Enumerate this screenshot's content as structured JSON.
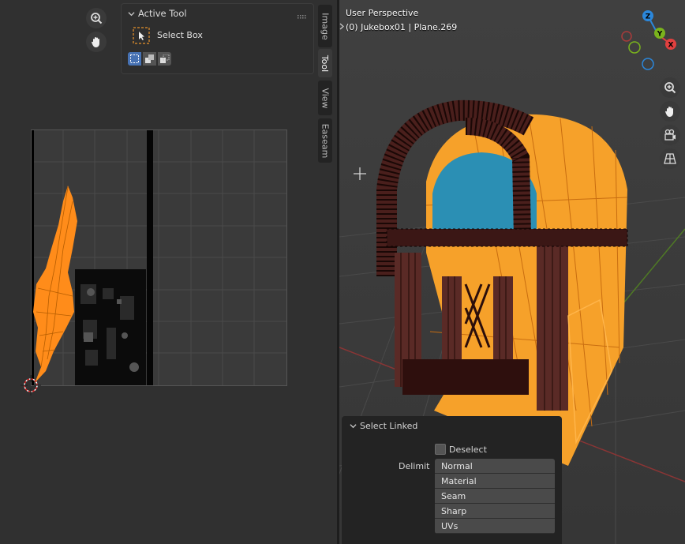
{
  "uv_editor": {
    "tool_panel": {
      "title": "Active Tool",
      "tool_name": "Select Box"
    },
    "side_tabs": [
      "Image",
      "Tool",
      "View",
      "Easeam"
    ],
    "active_tab": "Tool"
  },
  "viewport": {
    "perspective": "User Perspective",
    "object_info": "(0) Jukebox01 | Plane.269",
    "gizmo": {
      "x": "X",
      "y": "Y",
      "z": "Z"
    }
  },
  "select_linked": {
    "title": "Select Linked",
    "deselect_label": "Deselect",
    "deselect_checked": false,
    "delimit_label": "Delimit",
    "delimit_options": [
      "Normal",
      "Material",
      "Seam",
      "Sharp",
      "UVs"
    ]
  },
  "colors": {
    "selection": "#ff8c1a",
    "window_blue": "#2e8fb5",
    "wood": "#5a2a26",
    "x_axis": "#e2403f",
    "y_axis": "#7ab31d",
    "z_axis": "#2b87db"
  }
}
